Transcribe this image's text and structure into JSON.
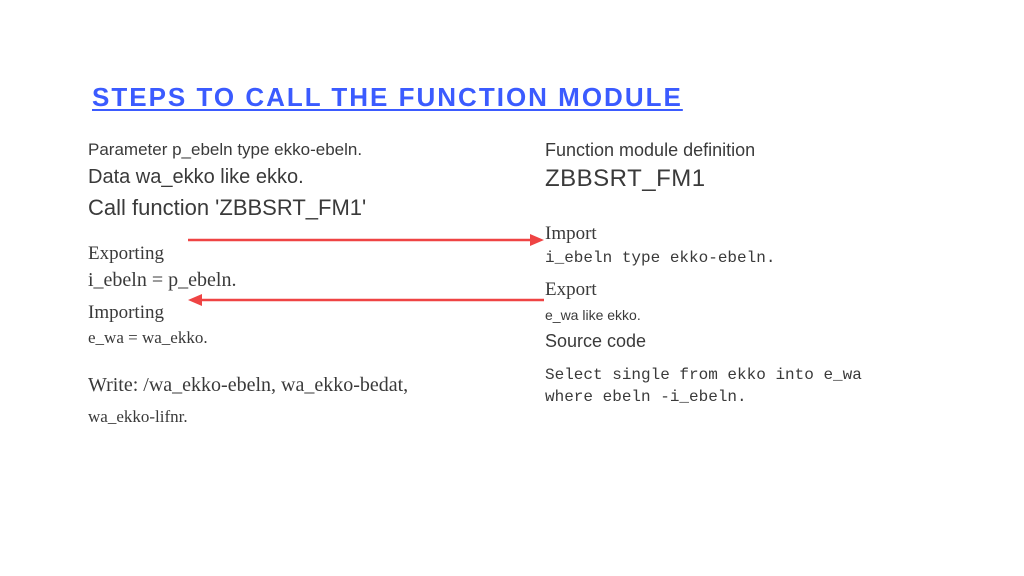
{
  "title": "STEPS TO CALL THE FUNCTION MODULE",
  "left": {
    "param": "Parameter p_ebeln type ekko-ebeln.",
    "data": "Data wa_ekko like ekko.",
    "call": "Call function 'ZBBSRT_FM1'",
    "exporting": "Exporting",
    "iebeln": "i_ebeln = p_ebeln.",
    "importing": "Importing",
    "ewa": "e_wa = wa_ekko.",
    "write": "Write: /wa_ekko-ebeln, wa_ekko-bedat,",
    "lifnr": "wa_ekko-lifnr."
  },
  "right": {
    "fmdef": "Function module definition",
    "fmname": "ZBBSRT_FM1",
    "import": "Import",
    "iebeln": "i_ebeln type ekko-ebeln.",
    "export": "Export",
    "ewa": "e_wa like ekko.",
    "source": "Source code",
    "code1": "Select single from ekko into e_wa",
    "code2": "where ebeln -i_ebeln."
  },
  "arrows": {
    "color": "#ef4444"
  }
}
